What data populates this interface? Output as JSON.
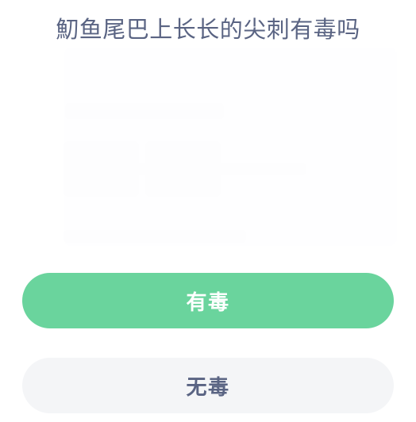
{
  "screen": {
    "name": "daily-quiz",
    "background_color": "#ffffff"
  },
  "question": {
    "title": "魛鱼尾巴上长长的尖刺有毒吗",
    "title_color": "#5a6483"
  },
  "answers": {
    "options": [
      {
        "id": "option-a",
        "label": "有毒",
        "style": "primary",
        "background_color": "#6ad49d",
        "text_color": "#ffffff"
      },
      {
        "id": "option-b",
        "label": "无毒",
        "style": "secondary",
        "background_color": "#f4f5f7",
        "text_color": "#5a6483"
      }
    ]
  }
}
